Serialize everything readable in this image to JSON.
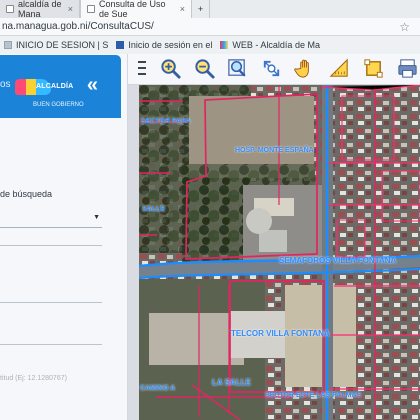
{
  "browser": {
    "tabs": [
      {
        "label": "alcaldía de Mana",
        "close": "×"
      },
      {
        "label": "Consulta de Uso de Sue",
        "close": "×"
      }
    ],
    "new_tab": "+",
    "url": "na.managua.gob.ni/ConsultaCUS/",
    "bookmarks": [
      {
        "label": "INICIO DE SESION | S"
      },
      {
        "label": "Inicio de sesión en el"
      },
      {
        "label": "WEB - Alcaldía de Ma"
      }
    ]
  },
  "left_panel": {
    "header_prefix": "os",
    "logo_text": "ALCALDÍA",
    "subtitle": "BUEN GOBIERNO",
    "collapse_icon": "«",
    "search_label": "de búsqueda",
    "select_caret": "▼",
    "coordinate_hint": "titud (Ej: 12.1280767)"
  },
  "toolbar": {
    "tools": [
      {
        "name": "zoom-in-icon"
      },
      {
        "name": "zoom-out-icon"
      },
      {
        "name": "zoom-box-icon"
      },
      {
        "name": "extent-icon"
      },
      {
        "name": "pan-hand-icon"
      },
      {
        "name": "measure-icon"
      },
      {
        "name": "area-icon"
      },
      {
        "name": "print-icon"
      }
    ]
  },
  "map": {
    "labels": [
      "SECTOR PAPA",
      "HOSP. MONTE ESPAÑA",
      "SALLE",
      "SEMAFOROS VILLA FONTANA",
      "TELCOR VILLA FONTANA",
      "LA SALLE",
      "SECTOR ESTE LAS PALMAS",
      "CAMINO A"
    ],
    "accent": "#1d84d8"
  }
}
